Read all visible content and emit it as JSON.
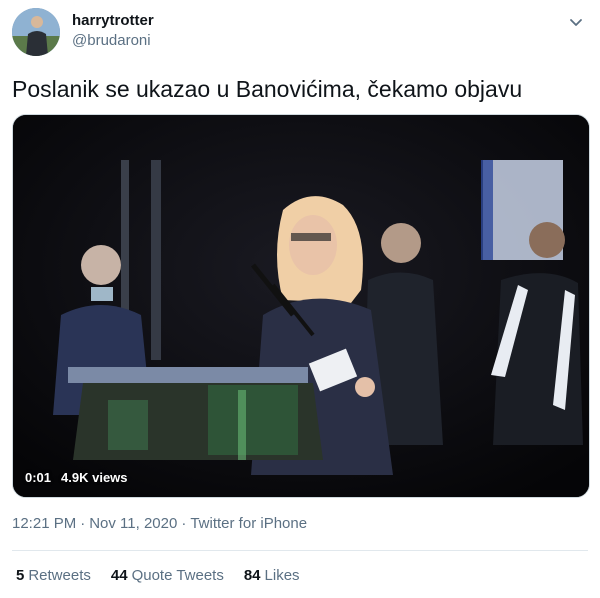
{
  "author": {
    "display_name": "harrytrotter",
    "handle": "@brudaroni",
    "avatar_icon": "avatar-photo-icon"
  },
  "tweet": {
    "text": "Poslanik se ukazao u Banovićima, čekamo objavu"
  },
  "video": {
    "time": "0:01",
    "views": "4.9K views"
  },
  "meta": {
    "time": "12:21 PM",
    "sep1": "·",
    "date": "Nov 11, 2020",
    "sep2": "·",
    "source": "Twitter for iPhone"
  },
  "stats": {
    "retweets_count": "5",
    "retweets_label": "Retweets",
    "quotes_count": "44",
    "quotes_label": "Quote Tweets",
    "likes_count": "84",
    "likes_label": "Likes"
  },
  "colors": {
    "secondary_text": "#5b7083",
    "primary_text": "#0f1419",
    "divider": "#e1e8ed"
  }
}
